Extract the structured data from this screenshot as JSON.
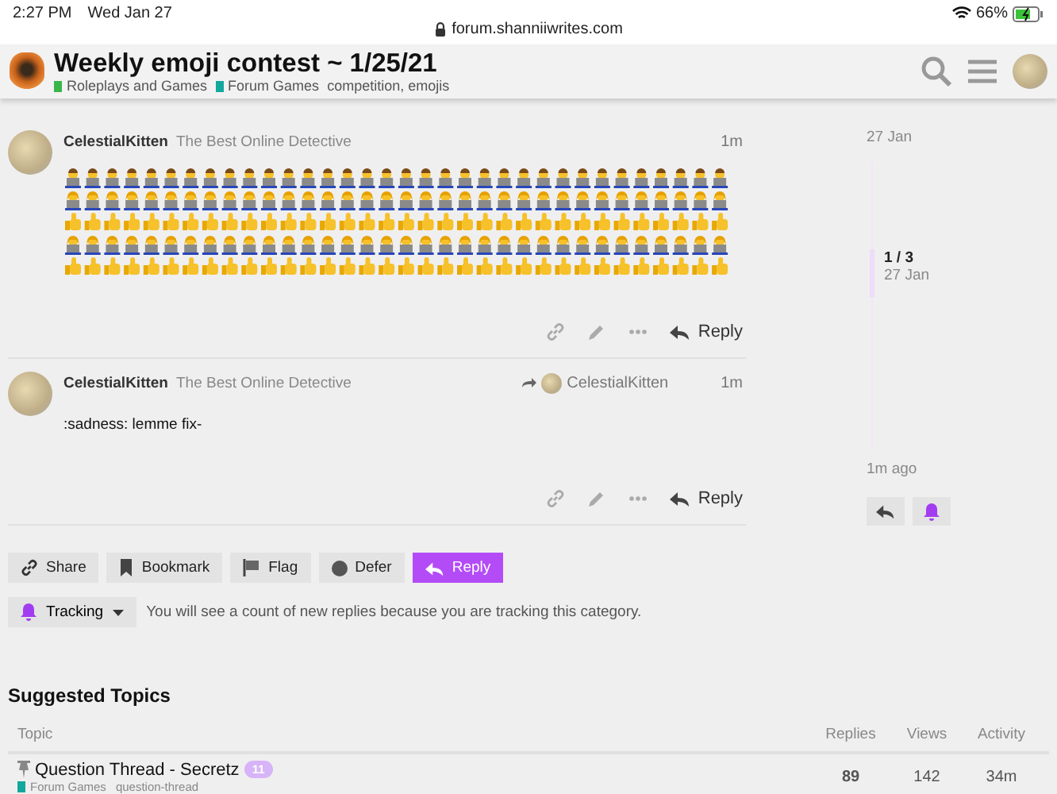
{
  "status_bar": {
    "time": "2:27 PM",
    "date": "Wed Jan 27",
    "url": "forum.shanniiwrites.com",
    "battery": "66%"
  },
  "header": {
    "title": "Weekly emoji contest ~ 1/25/21",
    "categories": [
      {
        "name": "Roleplays and Games",
        "color": "#3ab54a"
      },
      {
        "name": "Forum Games",
        "color": "#12a89d"
      }
    ],
    "tags": "competition, emojis"
  },
  "posts": [
    {
      "username": "CelestialKitten",
      "user_title": "The Best Online Detective",
      "time": "1m",
      "kind": "emoji",
      "reply_label": "Reply"
    },
    {
      "username": "CelestialKitten",
      "user_title": "The Best Online Detective",
      "time": "1m",
      "reply_to": "CelestialKitten",
      "kind": "text",
      "body": ":sadness: lemme fix-",
      "reply_label": "Reply"
    }
  ],
  "timeline": {
    "start": "27 Jan",
    "position": "1 / 3",
    "position_date": "27 Jan",
    "end": "1m ago",
    "level": 0.33
  },
  "footer_buttons": [
    {
      "label": "Share",
      "kind": "link",
      "primary": false
    },
    {
      "label": "Bookmark",
      "kind": "bookmark",
      "primary": false
    },
    {
      "label": "Flag",
      "kind": "flag",
      "primary": false
    },
    {
      "label": "Defer",
      "kind": "defer",
      "primary": false
    },
    {
      "label": "Reply",
      "kind": "reply",
      "primary": true
    }
  ],
  "tracking": {
    "label": "Tracking",
    "description": "You will see a count of new replies because you are tracking this category."
  },
  "suggested": {
    "title": "Suggested Topics",
    "columns": [
      "Topic",
      "Replies",
      "Views",
      "Activity"
    ],
    "rows": [
      {
        "title": "Question Thread - Secretz",
        "pinned": true,
        "badge": "11",
        "category": {
          "name": "Forum Games",
          "color": "#12a89d"
        },
        "tag": "question-thread",
        "replies": "89",
        "views": "142",
        "activity": "34m"
      }
    ]
  }
}
